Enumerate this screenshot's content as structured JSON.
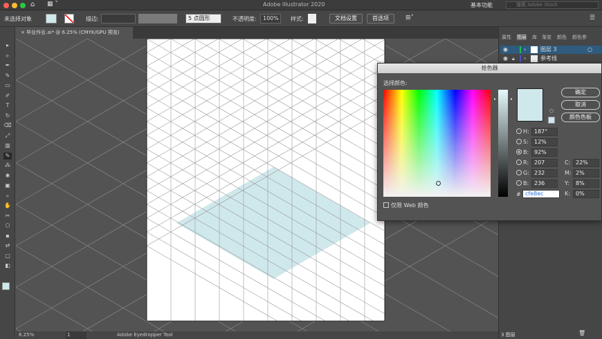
{
  "app": {
    "title": "Adobe Illustrator 2020",
    "workspace": "基本功能",
    "search_placeholder": "搜索 Adobe Stock"
  },
  "control": {
    "selection": "未选择对象",
    "stroke_label": "描边:",
    "brush": "5 点圆形",
    "opacity_label": "不透明度:",
    "opacity": "100%",
    "style_label": "样式:",
    "doc_setup": "文档设置",
    "prefs": "首选项"
  },
  "doc_tab": {
    "close": "×",
    "title": "毕业作业.ai* @ 6.25% (CMYK/GPU 预览)"
  },
  "status": {
    "zoom": "6.25%",
    "page": "1",
    "tool": "Adobe Eyedropper Tool"
  },
  "panel": {
    "tabs": [
      "属性",
      "图层",
      "库",
      "渐变",
      "颜色",
      "颜色参"
    ],
    "layers": [
      {
        "name": "图层 3",
        "color": "#1fbf4a"
      },
      {
        "name": "参考线",
        "color": "#4a55c8"
      }
    ],
    "count": "3 图层"
  },
  "picker": {
    "title": "拾色器",
    "select_label": "选择颜色:",
    "ok": "确定",
    "cancel": "取消",
    "swatches": "颜色色板",
    "web_only": "仅限 Web 颜色",
    "hsb": [
      {
        "label": "H:",
        "value": "187°"
      },
      {
        "label": "S:",
        "value": "12%"
      },
      {
        "label": "B:",
        "value": "92%"
      }
    ],
    "rgb": [
      {
        "label": "R:",
        "value": "207"
      },
      {
        "label": "G:",
        "value": "232"
      },
      {
        "label": "B:",
        "value": "236"
      }
    ],
    "cmyk": [
      {
        "label": "C:",
        "value": "22%"
      },
      {
        "label": "M:",
        "value": "2%"
      },
      {
        "label": "Y:",
        "value": "8%"
      },
      {
        "label": "K:",
        "value": "0%"
      }
    ],
    "hex_label": "#",
    "hex": "cfe8ec",
    "selected_channel": "B"
  },
  "colors": {
    "fill": "#cfe8ec",
    "accent": "#2f5b7e"
  }
}
